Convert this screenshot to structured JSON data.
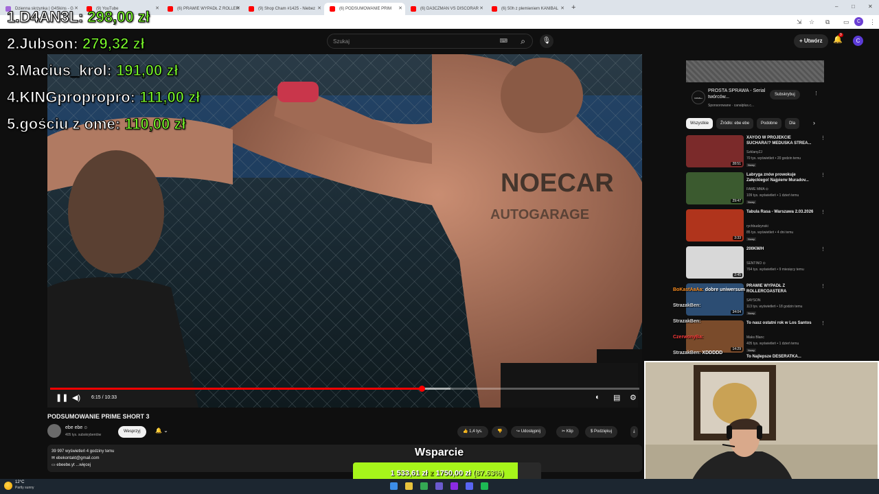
{
  "browser": {
    "tabs": [
      {
        "title": "Dzienna skrzynka | G4Skins - G",
        "fav_color": "#a36ad9"
      },
      {
        "title": "(9) YouTube",
        "fav_color": "#ff0000"
      },
      {
        "title": "(6) PRAWIE WYPADŁ Z ROLLER",
        "fav_color": "#ff0000"
      },
      {
        "title": "(9) Shop Cham #1425 - Niebez",
        "fav_color": "#ff0000"
      },
      {
        "title": "(6) PODSUMOWANIE PRIM",
        "fav_color": "#ff0000",
        "active": true
      },
      {
        "title": "(6) DA3CZMAN VS DISCORAR",
        "fav_color": "#ff0000"
      },
      {
        "title": "(6) 50h z plemieniem KANIBAL",
        "fav_color": "#ff0000"
      }
    ],
    "new_tab_glyph": "+",
    "window_controls": [
      "–",
      "□",
      "✕"
    ]
  },
  "youtube": {
    "logo": "YouTube",
    "search_placeholder": "Szukaj",
    "create_label": "Utwórz",
    "notification_count": "9",
    "avatar_letter": "C",
    "player": {
      "time": "6:15 / 10:33",
      "progress": 0.63,
      "buffered": 0.68
    },
    "video": {
      "title": "PODSUMOWANIE PRIME SHORT 3",
      "channel": "ebe ebe",
      "verified": "⊙",
      "subscribers": "405 tys. subskrybentów",
      "support_label": "Wesprzyj",
      "likes": "1,4 tys.",
      "share_label": "Udostępnij",
      "clip_label": "Klip",
      "thanks_label": "Podziękuj",
      "description_stats": "39 997 wyświetleń  4 godziny temu",
      "description_line1": "ebekontakt@gmail.com",
      "description_line2": "ebeebe.yt ...więcej"
    },
    "ad": {
      "title": "PROSTA SPRAWA - Serial twórców...",
      "meta": "Sponsorowane · canalplus.c...",
      "logo_text": "CANAL+",
      "subscribe_label": "Subskrybuj"
    },
    "chips": [
      "Wszystkie",
      "Źródło: ebe ebe",
      "Podobne",
      "Dla"
    ],
    "recommendations": [
      {
        "title": "XAYOO W PROJEKCIE SUCHARA!? MEDUSKA STREA...",
        "channel": "SzklanyZJ",
        "views": "70 tys. wyświetleń • 20 godzin temu",
        "badge": "Nowy",
        "duration": "28:51",
        "thumb_color": "#7b2a2a"
      },
      {
        "title": "Labryga znów prowokuje Załęckiego! Najpierw Muradov...",
        "channel": "FAME MMA ⊙",
        "views": "109 tys. wyświetleń • 1 dzień temu",
        "badge": "Nowy",
        "duration": "29:47",
        "thumb_color": "#3b5a2f"
      },
      {
        "title": "Tabula Rasa - Warszawa 2.03.2026",
        "channel": "rychbudzynski",
        "views": "85 tys. wyświetleń • 4 dni temu",
        "badge": "Nowy",
        "duration": "3:33",
        "thumb_color": "#b0341c"
      },
      {
        "title": "200KM/H",
        "channel": "SENTINO ⊙",
        "views": "764 tys. wyświetleń • 9 miesięcy temu",
        "badge": "",
        "duration": "2:45",
        "thumb_color": "#d8d8d8"
      },
      {
        "title": "PRAWIE WYPADŁ Z ROLLERCOASTERA",
        "channel": "SAYSON",
        "views": "113 tys. wyświetleń • 18 godzin temu",
        "badge": "Nowy",
        "duration": "34:04",
        "thumb_color": "#2c4d73"
      },
      {
        "title": "To nasz ostatni rok w Los Santos",
        "channel": "Maks Blanc",
        "views": "405 tys. wyświetleń • 1 dzień temu",
        "badge": "Nowy",
        "duration": "14:29",
        "thumb_color": "#7a4b2b"
      }
    ],
    "rec_partial_title": "To Najlepsze DESERATKA..."
  },
  "overlay": {
    "leaderboard": [
      {
        "rank": "1.",
        "name": "D4AN3L:",
        "amount": "298,00 zł"
      },
      {
        "rank": "2.",
        "name": "Jubson:",
        "amount": "279,32 zł"
      },
      {
        "rank": "3.",
        "name": "Macius_krol:",
        "amount": "191,00 zł"
      },
      {
        "rank": "4.",
        "name": "KINGpropropro:",
        "amount": "111,00 zł"
      },
      {
        "rank": "5.",
        "name": "gościu z ome:",
        "amount": "110,00 zł"
      }
    ],
    "chat": [
      {
        "user": "BoKastAaAa:",
        "msg": "dobre uniwersum",
        "color": "#ff8f1f"
      },
      {
        "user": "StrazakBen:",
        "msg": "",
        "color": "#dddddd"
      },
      {
        "user": "StrazakBen:",
        "msg": "",
        "color": "#dddddd"
      },
      {
        "user": "CzerwonyBa:",
        "msg": "",
        "color": "#ff3b3b"
      },
      {
        "user": "StrazakBen:",
        "msg": "XDDDDD",
        "color": "#dddddd"
      }
    ],
    "goal": {
      "title": "Wsparcie",
      "current": "1 533,61 zł",
      "separator": "z",
      "target": "1750,00 zł",
      "percent": "(87.63%)",
      "fraction": 0.8763
    }
  },
  "taskbar": {
    "temperature": "12°C",
    "weather": "Partly sunny"
  }
}
